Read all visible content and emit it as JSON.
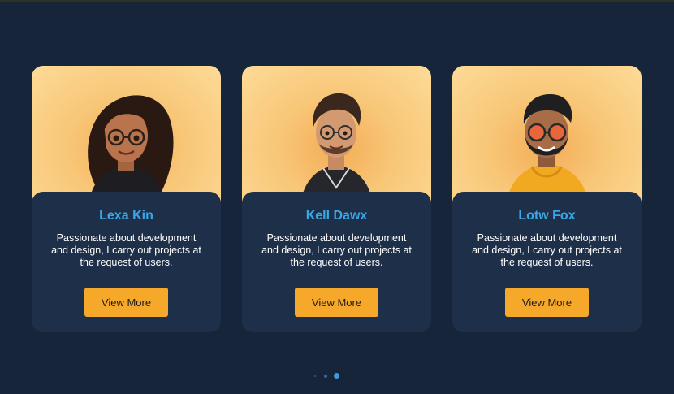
{
  "cards": [
    {
      "name": "Lexa Kin",
      "description": "Passionate about development and design, I carry out projects at the request of users.",
      "button_label": "View More",
      "avatar_icon": "female-avatar-icon"
    },
    {
      "name": "Kell Dawx",
      "description": "Passionate about development and design, I carry out projects at the request of users.",
      "button_label": "View More",
      "avatar_icon": "male-avatar-glasses-icon"
    },
    {
      "name": "Lotw Fox",
      "description": "Passionate about development and design, I carry out projects at the request of users.",
      "button_label": "View More",
      "avatar_icon": "bearded-avatar-sunglasses-icon"
    }
  ],
  "pagination": {
    "total": 3,
    "active": 3
  },
  "colors": {
    "background": "#17253a",
    "card": "#1e3049",
    "name": "#3ba7e6",
    "button": "#f5a82a",
    "dot_active": "#3a9be3"
  }
}
